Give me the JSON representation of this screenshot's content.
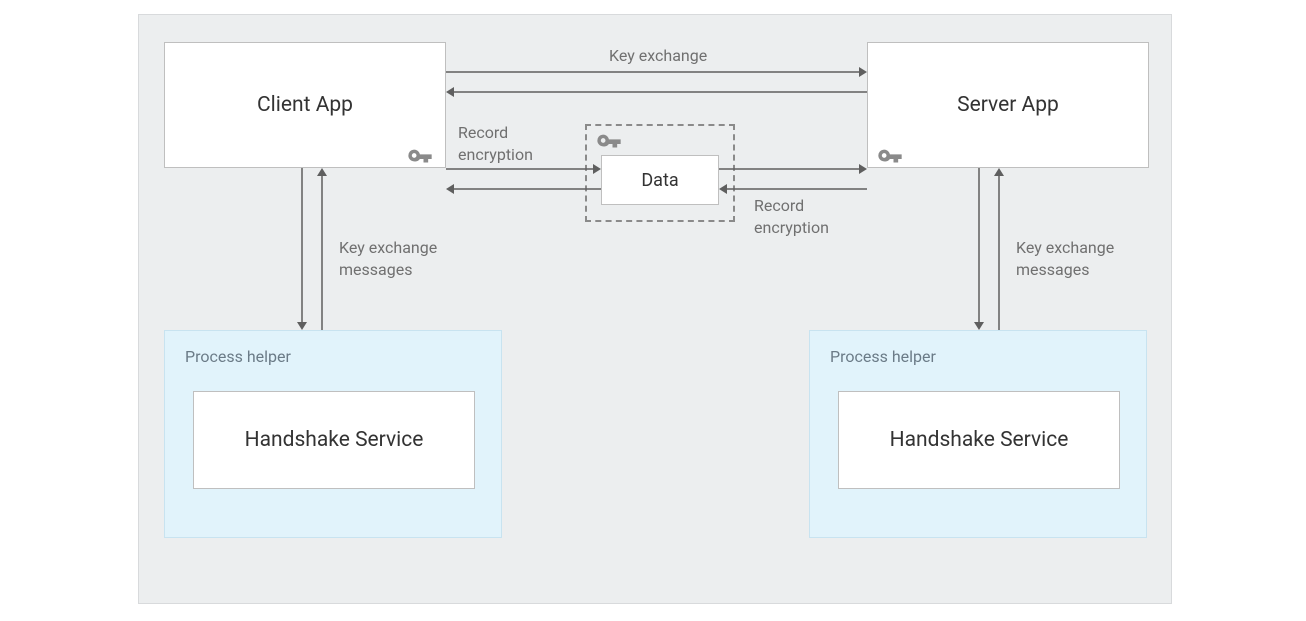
{
  "boxes": {
    "client_app": "Client App",
    "server_app": "Server App",
    "data": "Data",
    "handshake_service_left": "Handshake Service",
    "handshake_service_right": "Handshake Service"
  },
  "labels": {
    "process_helper_left": "Process helper",
    "process_helper_right": "Process helper",
    "key_exchange_top": "Key exchange",
    "record_encryption_left": "Record\nencryption",
    "record_encryption_right": "Record\nencryption",
    "key_exchange_messages_left": "Key exchange\nmessages",
    "key_exchange_messages_right": "Key exchange\nmessages"
  },
  "icons": {
    "key": "key-icon"
  },
  "colors": {
    "bg": "#eceeef",
    "box_border": "#bfbfbf",
    "helper_bg": "#e1f3fb",
    "text": "#333",
    "label": "#707070",
    "arrow": "#5f5f5f"
  }
}
